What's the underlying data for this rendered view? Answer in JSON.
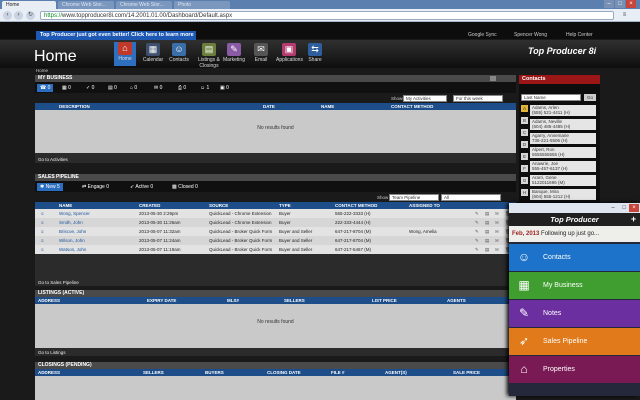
{
  "browser": {
    "tab_active": "Home",
    "tabs_ghost": [
      "Chrome Web Stor...",
      "Chrome Web Stor...",
      "Photo"
    ],
    "url_secure": "https://",
    "url_rest": "www.topproducer8i.com/14.2001.01.00/Dashboard/Default.aspx"
  },
  "topbar": {
    "promo": "Top Producer just got even better! Click here to learn more",
    "google_sync": "Google Sync",
    "user": "Spencer Wong",
    "help": "Help Center"
  },
  "hero": {
    "title": "Home",
    "brand": "Top Producer 8i",
    "apps": [
      {
        "label": "Home",
        "icon": "home-icon"
      },
      {
        "label": "Calendar",
        "icon": "calendar-icon"
      },
      {
        "label": "Contacts",
        "icon": "contacts-icon"
      },
      {
        "label": "Listings & Closings",
        "icon": "listings-icon"
      },
      {
        "label": "Marketing",
        "icon": "marketing-icon"
      },
      {
        "label": "Email",
        "icon": "email-icon"
      },
      {
        "label": "Applications",
        "icon": "applications-icon"
      },
      {
        "label": "Share",
        "icon": "share-icon"
      }
    ]
  },
  "breadcrumb": "Home",
  "mybusiness": {
    "title": "MY BUSINESS",
    "counts": [
      "0",
      "0",
      "0",
      "0",
      "0",
      "0",
      "0",
      "1",
      "0"
    ],
    "shows_label": "Shows",
    "shows_value": "My Activities",
    "period_value": "For this week",
    "columns": [
      "DESCRIPTION",
      "DATE",
      "NAME",
      "CONTACT METHOD"
    ],
    "empty": "No results found",
    "goto": "Go to Activities"
  },
  "pipeline": {
    "title": "SALES PIPELINE",
    "tabs": [
      {
        "label": "New",
        "count": "5"
      },
      {
        "label": "Engage",
        "count": "0"
      },
      {
        "label": "Active",
        "count": "0"
      },
      {
        "label": "Closed",
        "count": "0"
      }
    ],
    "show_label": "Show",
    "show_value": "Team Pipeline",
    "show_value2": "All",
    "columns": [
      "NAME",
      "CREATED",
      "SOURCE",
      "TYPE",
      "CONTACT METHOD",
      "ASSIGNED TO"
    ],
    "rows": [
      {
        "name": "Wong, Spencer",
        "created": "2013-05-30 2:29pm",
        "source": "QuickLead - Chrome Extension",
        "type": "Buyer",
        "contact": "555-222-3333 (H)",
        "assigned": ""
      },
      {
        "name": "Smith, John",
        "created": "2013-05-30 11:26am",
        "source": "QuickLead - Chrome Extension",
        "type": "Buyer",
        "contact": "222-333-4444 (H)",
        "assigned": ""
      },
      {
        "name": "Briscoe, John",
        "created": "2013-05-07 11:32am",
        "source": "QuickLead - Broker Quick Form",
        "type": "Buyer and Seller",
        "contact": "647-217-8704 (M)",
        "assigned": "Wong, Amelia"
      },
      {
        "name": "Wilson, John",
        "created": "2013-05-07 11:24am",
        "source": "QuickLead - Broker Quick Form",
        "type": "Buyer and Seller",
        "contact": "647-217-8704 (M)",
        "assigned": ""
      },
      {
        "name": "Watson, John",
        "created": "2013-05-07 11:19am",
        "source": "QuickLead - Broker Quick Form",
        "type": "Buyer and Seller",
        "contact": "647-217-5467 (M)",
        "assigned": ""
      }
    ],
    "goto": "Go to Sales Pipeline"
  },
  "listings": {
    "title": "LISTINGS (ACTIVE)",
    "columns": [
      "ADDRESS",
      "EXPIRY DATE",
      "MLS#",
      "SELLERS",
      "LIST PRICE",
      "AGENTS"
    ],
    "empty": "No results found",
    "goto": "Go to Listings"
  },
  "closings": {
    "title": "CLOSINGS (PENDING)",
    "columns": [
      "ADDRESS",
      "SELLERS",
      "BUYERS",
      "CLOSING DATE",
      "FILE #",
      "AGENT(S)",
      "SALE PRICE"
    ]
  },
  "contacts_panel": {
    "title": "Contacts",
    "filter": "Last Name",
    "go": "Go",
    "letters": [
      "A",
      "B",
      "C",
      "D",
      "E",
      "F",
      "G",
      "H"
    ],
    "entries": [
      {
        "name": "Adams, Arlen",
        "detail": "(555) 521-4411 (H)"
      },
      {
        "name": "Adams, Neville",
        "detail": "(604) 485-4485 (H)"
      },
      {
        "name": "Agarry, Annemarie",
        "detail": "736-221-5506 (H)"
      },
      {
        "name": "Alpert, Ron",
        "detail": "5555555555 (H)"
      },
      {
        "name": "Anawrie, Joe",
        "detail": "555-457-6137 (H)"
      },
      {
        "name": "Ararri, Gene",
        "detail": "5122011696 (M)"
      },
      {
        "name": "Banque, Mira",
        "detail": "(604) 555-1212 (H)"
      }
    ]
  },
  "widget": {
    "logo": "Top Producer",
    "note_date": "Feb, 2013",
    "note_text": "Following up just go...",
    "buttons": [
      {
        "label": "Contacts",
        "icon": "people-icon",
        "color": "#1d73c9"
      },
      {
        "label": "My Business",
        "icon": "business-icon",
        "color": "#3f9e2f"
      },
      {
        "label": "Notes",
        "icon": "notes-icon",
        "color": "#6b2fa0"
      },
      {
        "label": "Sales Pipeline",
        "icon": "pipeline-icon",
        "color": "#e07a1a"
      },
      {
        "label": "Properties",
        "icon": "house-icon",
        "color": "#7a1a55"
      }
    ]
  }
}
